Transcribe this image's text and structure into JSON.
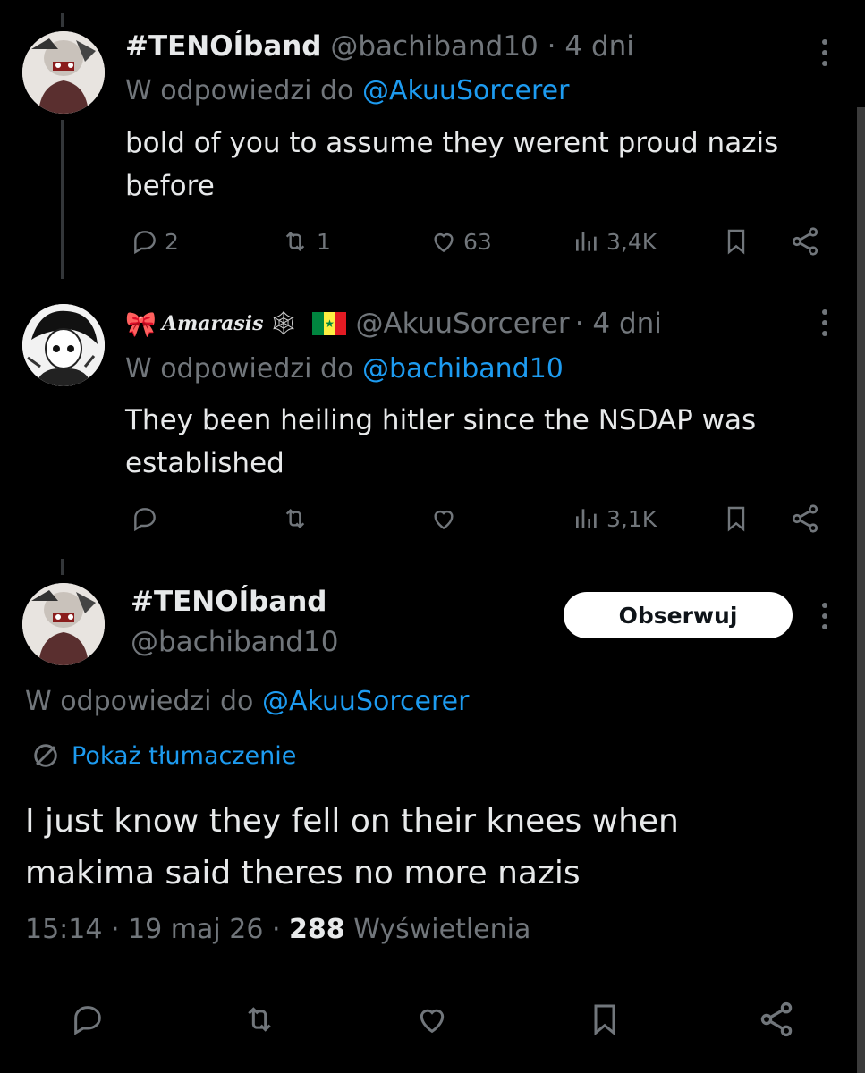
{
  "tweets": [
    {
      "display_name": "#TENOÍband",
      "handle": "@bachiband10",
      "time": "· 4 dni",
      "reply_prefix": "W odpowiedzi do",
      "reply_to": "@AkuuSorcerer",
      "text_line1": "bold of you to assume they werent proud nazis",
      "text_line2": "before",
      "replies": "2",
      "retweets": "1",
      "likes": "63",
      "views": "3,4K"
    },
    {
      "display_name": "Amarasis",
      "name_emoji_left": "🎀",
      "name_emoji_right": "🕸",
      "flag": "🇸🇳",
      "handle": "@AkuuSorcerer",
      "time": "· 4 dni",
      "reply_prefix": "W odpowiedzi do",
      "reply_to": "@bachiband10",
      "text_line1": "They been heiling hitler since the NSDAP was",
      "text_line2": "established",
      "views": "3,1K"
    }
  ],
  "main_tweet": {
    "display_name": "#TENOÍband",
    "handle": "@bachiband10",
    "follow_label": "Obserwuj",
    "reply_prefix": "W odpowiedzi do",
    "reply_to": "@AkuuSorcerer",
    "translate_label": "Pokaż tłumaczenie",
    "text_line1": "I just know they fell on their knees when",
    "text_line2": "makima said theres no more nazis",
    "time": "15:14 · 19 maj 26 ·",
    "views_count": "288",
    "views_label": "Wyświetlenia"
  },
  "icons": [
    "reply-icon",
    "retweet-icon",
    "like-icon",
    "views-icon",
    "bookmark-icon",
    "share-icon",
    "more-icon",
    "globe-icon"
  ],
  "colors": {
    "background": "#000000",
    "text": "#e7e9ea",
    "muted": "#71767b",
    "link": "#1d9bf0"
  }
}
